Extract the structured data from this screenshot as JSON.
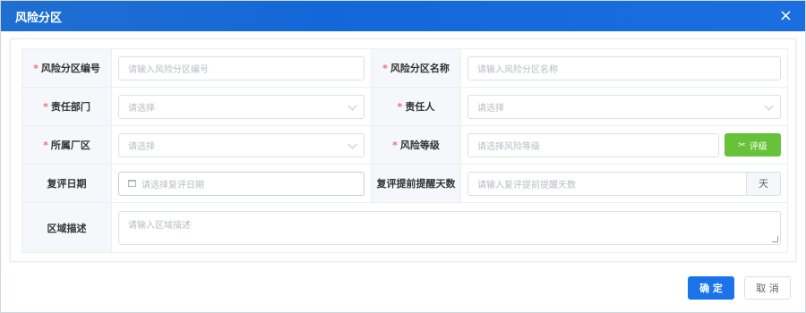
{
  "dialog": {
    "title": "风险分区",
    "close_label": "×"
  },
  "form": {
    "row1": {
      "code_label": "风险分区编号",
      "code_placeholder": "请输入风险分区编号",
      "name_label": "风险分区名称",
      "name_placeholder": "请输入风险分区名称"
    },
    "row2": {
      "dept_label": "责任部门",
      "dept_placeholder": "请选择",
      "person_label": "责任人",
      "person_placeholder": "请选择"
    },
    "row3": {
      "plant_label": "所属厂区",
      "plant_placeholder": "请选择",
      "level_label": "风险等级",
      "level_placeholder": "请选择风险等级",
      "rate_button": "评级"
    },
    "row4": {
      "date_label": "复评日期",
      "date_placeholder": "请选择复评日期",
      "remind_label": "复评提前提醒天数",
      "remind_placeholder": "请输入复评提前提醒天数",
      "remind_suffix": "天"
    },
    "row5": {
      "desc_label": "区域描述",
      "desc_placeholder": "请输入区域描述"
    },
    "required_mark": "*"
  },
  "footer": {
    "confirm": "确 定",
    "cancel": "取 消"
  },
  "colors": {
    "title_bar": "#1a6ee0",
    "primary": "#1a73e8",
    "success": "#67c23a",
    "required": "#f56c6c"
  }
}
